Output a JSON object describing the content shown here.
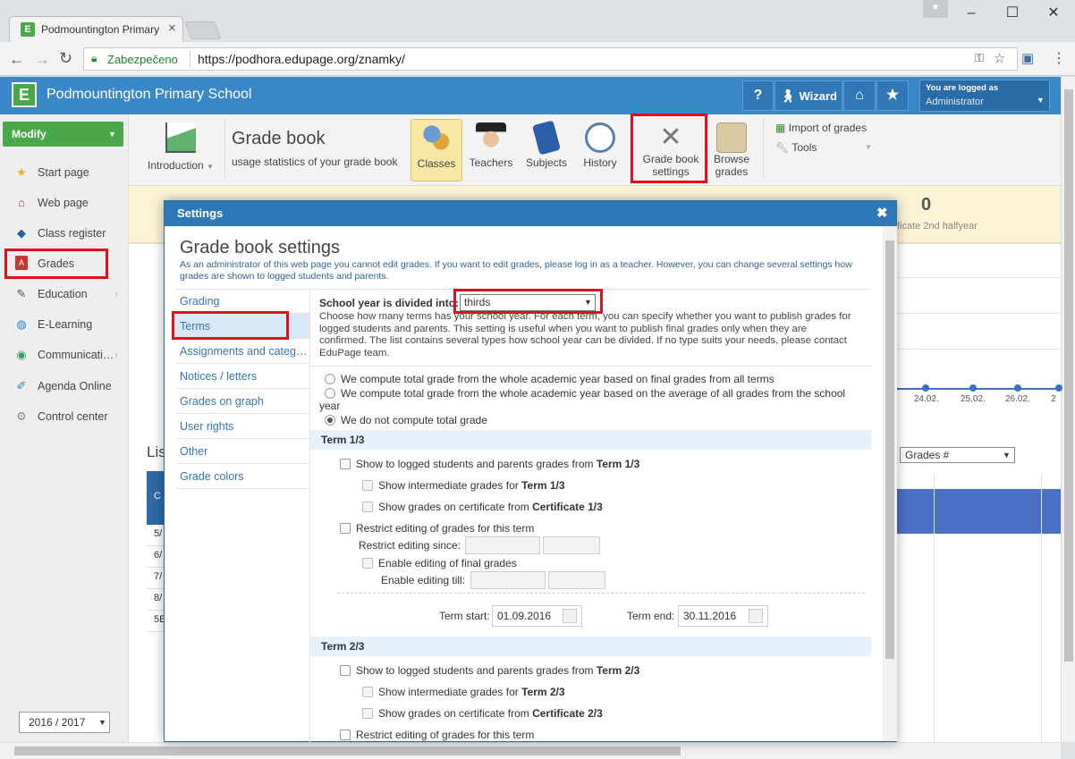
{
  "browser": {
    "tab_title": "Podmountington Primary",
    "secure_label": "Zabezpečeno",
    "url": "https://podhora.edupage.org/znamky/"
  },
  "header": {
    "school_name": "Podmountington Primary School",
    "help_label": "?",
    "wizard_label": "Wizard",
    "logged_label": "You are logged as",
    "user": "Administrator"
  },
  "sidebar": {
    "modify_label": "Modify",
    "items": [
      {
        "label": "Start page",
        "icon": "star-icon"
      },
      {
        "label": "Web page",
        "icon": "web-icon"
      },
      {
        "label": "Class register",
        "icon": "book-icon"
      },
      {
        "label": "Grades",
        "icon": "grades-icon"
      },
      {
        "label": "Education",
        "icon": "education-icon"
      },
      {
        "label": "E-Learning",
        "icon": "globe-icon"
      },
      {
        "label": "Communicati…",
        "icon": "communication-icon"
      },
      {
        "label": "Agenda Online",
        "icon": "pen-icon"
      },
      {
        "label": "Control center",
        "icon": "gear-icon"
      }
    ],
    "year": "2016 / 2017"
  },
  "toolbar": {
    "introduction": "Introduction",
    "title": "Grade book",
    "subtitle": "usage statistics of your grade book",
    "classes": "Classes",
    "teachers": "Teachers",
    "subjects": "Subjects",
    "history": "History",
    "settings_l1": "Grade book",
    "settings_l2": "settings",
    "browse_l1": "Browse",
    "browse_l2": "grades",
    "import": "Import of grades",
    "tools": "Tools"
  },
  "stats": {
    "value": "0",
    "caption": "ficate 2nd halfyear"
  },
  "background": {
    "list_label": "Lis",
    "table_head": "C",
    "rows": [
      "5/",
      "6/",
      "7/",
      "8/",
      "5E"
    ],
    "grades_select": "Grades #",
    "dates": [
      "24.02.",
      "25.02.",
      "26.02.",
      "2"
    ]
  },
  "dialog": {
    "title": "Settings",
    "heading": "Grade book settings",
    "intro": "As an administrator of this web page you cannot edit grades. If you want to edit grades, please log in as a teacher. However, you can change several settings how grades are shown to logged students and parents.",
    "nav": [
      "Grading",
      "Terms",
      "Assignments and categ…",
      "Notices / letters",
      "Grades on graph",
      "User rights",
      "Other",
      "Grade colors"
    ],
    "division_label": "School year is divided into:",
    "division_value": "thirds",
    "division_help": "Choose how many terms has your school year. For each term, you can specify whether you want to publish grades for logged students and parents. This setting is useful when you want to publish final grades only when they are confirmed. The list contains several types how school year can be divided. If no type suits your needs, please contact EduPage team.",
    "radio1": "We compute total grade from the whole academic year based on final grades from all terms",
    "radio2": "We compute total grade from the whole academic year based on the average of all grades from the school year",
    "radio3": "We do not compute total grade",
    "term1": {
      "title": "Term 1/3",
      "show": "Show to logged students and parents grades from",
      "show_b": "Term 1/3",
      "intermediate": "Show intermediate grades for",
      "intermediate_b": "Term 1/3",
      "certificate": "Show grades on certificate from",
      "certificate_b": "Certificate 1/3",
      "restrict": "Restrict editing of grades for this term",
      "restrict_since": "Restrict editing since:",
      "enable_final": "Enable editing of final grades",
      "enable_till": "Enable editing till:",
      "start_label": "Term start:",
      "start": "01.09.2016",
      "end_label": "Term end:",
      "end": "30.11.2016"
    },
    "term2": {
      "title": "Term 2/3",
      "show": "Show to logged students and parents grades from",
      "show_b": "Term 2/3",
      "intermediate": "Show intermediate grades for",
      "intermediate_b": "Term 2/3",
      "certificate": "Show grades on certificate from",
      "certificate_b": "Certificate 2/3",
      "restrict": "Restrict editing of grades for this term"
    }
  },
  "colors": {
    "header": "#3a87c8",
    "highlight": "#e0111b",
    "modify": "#4aa84a"
  }
}
